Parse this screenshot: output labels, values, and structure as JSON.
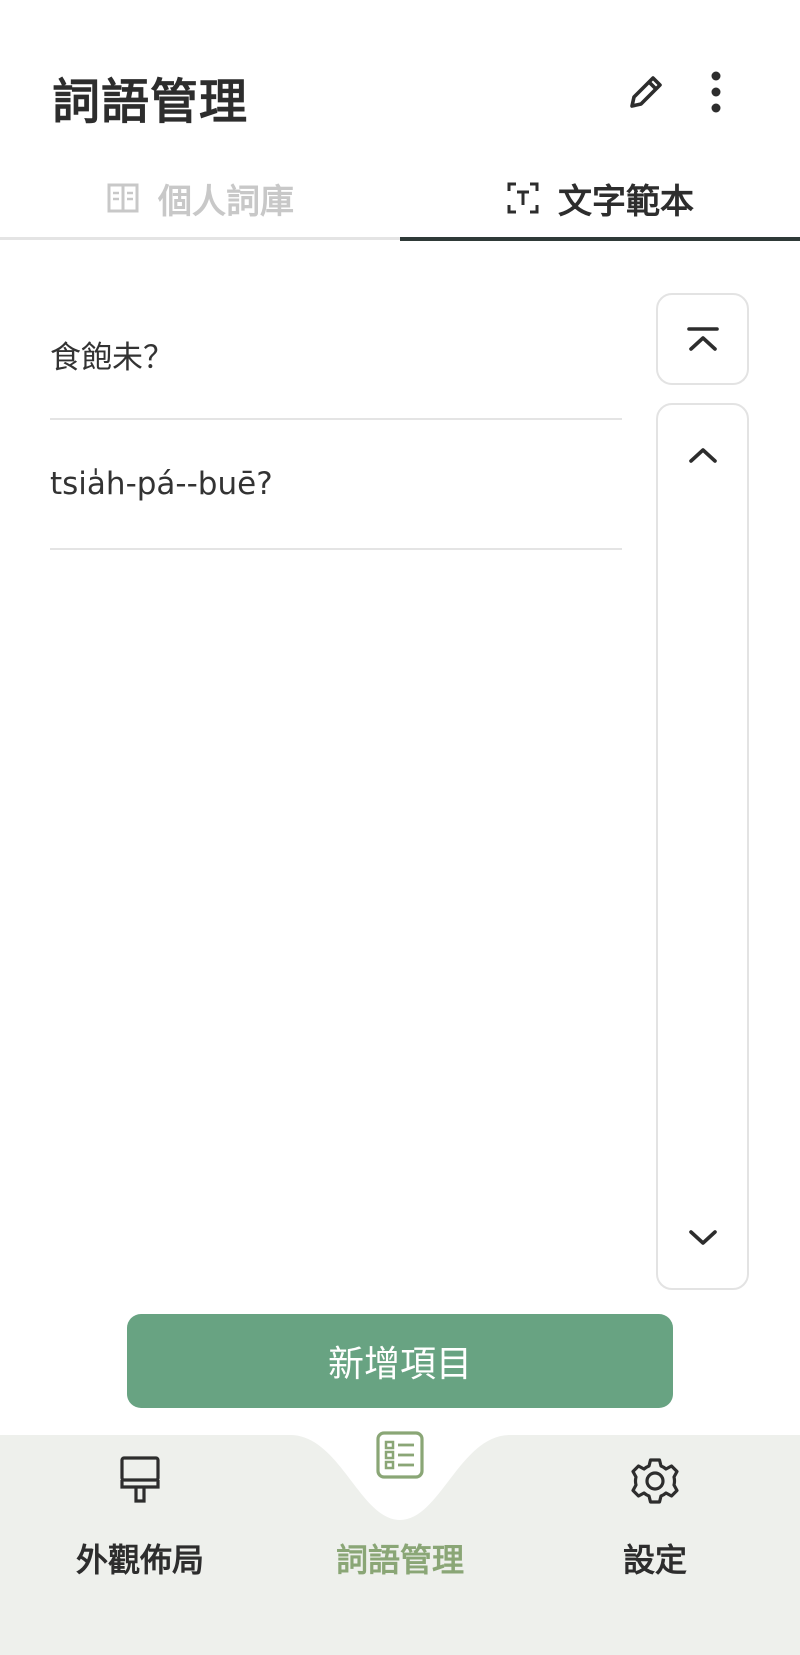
{
  "header": {
    "title": "詞語管理",
    "edit_icon": "pencil-icon",
    "more_icon": "more-vertical-icon"
  },
  "tabs": [
    {
      "label": "個人詞庫",
      "icon": "book-icon",
      "active": false
    },
    {
      "label": "文字範本",
      "icon": "text-frame-icon",
      "active": true
    }
  ],
  "items": [
    {
      "text": "食飽未？"
    },
    {
      "text": "tsia̍h-pá--buē?"
    }
  ],
  "scroll_controls": {
    "top_icon": "scroll-to-top-icon",
    "up_icon": "chevron-up-icon",
    "down_icon": "chevron-down-icon"
  },
  "add_button": {
    "label": "新增項目"
  },
  "bottom_nav": [
    {
      "label": "外觀佈局",
      "icon": "paint-brush-icon",
      "active": false
    },
    {
      "label": "詞語管理",
      "icon": "list-icon",
      "active": true
    },
    {
      "label": "設定",
      "icon": "gear-icon",
      "active": false
    }
  ],
  "colors": {
    "accent": "#68a382",
    "nav_active": "#8aa676",
    "nav_background": "#eef0ec",
    "text": "#2d2d2d",
    "tab_indicator": "#2f3a38"
  }
}
